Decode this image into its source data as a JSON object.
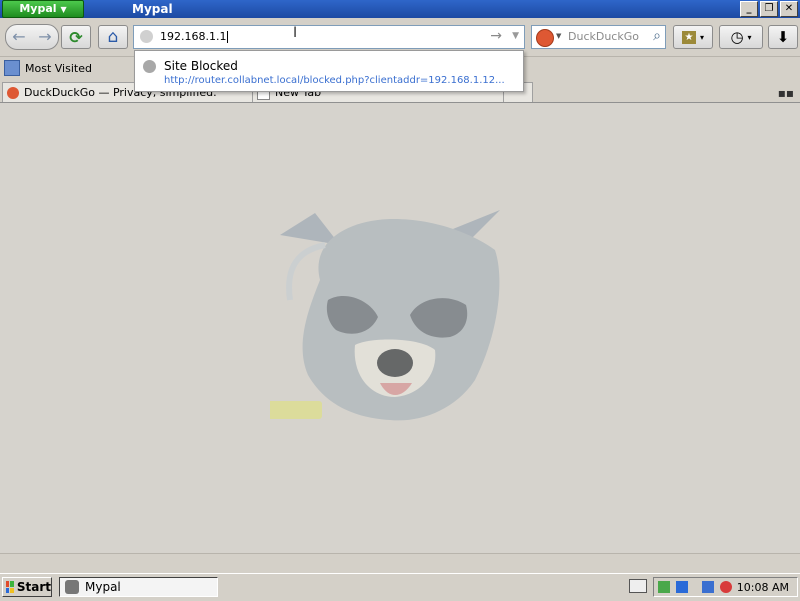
{
  "window": {
    "app_menu": "Mypal",
    "title": "Mypal"
  },
  "window_buttons": {
    "minimize": "_",
    "restore": "❐",
    "close": "✕"
  },
  "toolbar": {
    "back": "←",
    "forward": "→",
    "reload": "⟳",
    "home": "⌂",
    "bookmarks": "★",
    "history": "◷",
    "download": "⬇",
    "menu_arrow": "▾"
  },
  "address": {
    "value": "192.168.1.1",
    "go": "→",
    "drop": "▼"
  },
  "search": {
    "placeholder": "DuckDuckGo",
    "engine_arrow": "▼",
    "icon": "⌕"
  },
  "bookmarks_bar": [
    {
      "label": "Most Visited"
    }
  ],
  "tabs": [
    {
      "label": "DuckDuckGo — Privacy, simplified."
    },
    {
      "label": "New Tab"
    }
  ],
  "autocomplete": {
    "title": "Site Blocked",
    "url": "http://router.collabnet.local/blocked.php?clientaddr=192.168.1.12..."
  },
  "taskbar": {
    "start": "Start",
    "task": "Mypal",
    "clock": "10:08 AM"
  },
  "colors": {
    "titlebar": "#1d4aa3",
    "app_menu": "#1f8c1f",
    "link": "#3a6fd0",
    "duckduckgo": "#de5833"
  },
  "icons": [
    "back-icon",
    "forward-icon",
    "reload-icon",
    "home-icon",
    "globe-icon",
    "search-icon",
    "star-icon",
    "clock-icon",
    "download-icon",
    "raccoon-logo"
  ]
}
